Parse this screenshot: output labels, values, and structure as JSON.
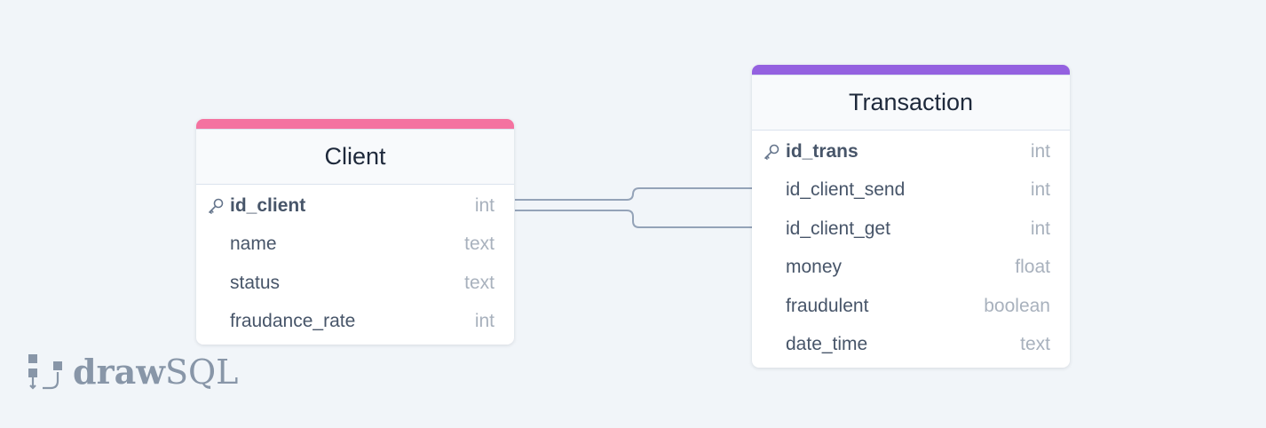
{
  "colors": {
    "client_accent": "#f472a0",
    "transaction_accent": "#9461e0",
    "connector": "#94a3b8"
  },
  "tables": {
    "client": {
      "title": "Client",
      "fields": [
        {
          "name": "id_client",
          "type": "int",
          "pk": true
        },
        {
          "name": "name",
          "type": "text",
          "pk": false
        },
        {
          "name": "status",
          "type": "text",
          "pk": false
        },
        {
          "name": "fraudance_rate",
          "type": "int",
          "pk": false
        }
      ]
    },
    "transaction": {
      "title": "Transaction",
      "fields": [
        {
          "name": "id_trans",
          "type": "int",
          "pk": true
        },
        {
          "name": "id_client_send",
          "type": "int",
          "pk": false
        },
        {
          "name": "id_client_get",
          "type": "int",
          "pk": false
        },
        {
          "name": "money",
          "type": "float",
          "pk": false
        },
        {
          "name": "fraudulent",
          "type": "boolean",
          "pk": false
        },
        {
          "name": "date_time",
          "type": "text",
          "pk": false
        }
      ]
    }
  },
  "relations": [
    {
      "from": "client.id_client",
      "to": "transaction.id_client_send"
    },
    {
      "from": "client.id_client",
      "to": "transaction.id_client_get"
    }
  ],
  "logo": {
    "bold": "draw",
    "light": "SQL",
    "icon": "drawsql-logo-icon"
  }
}
